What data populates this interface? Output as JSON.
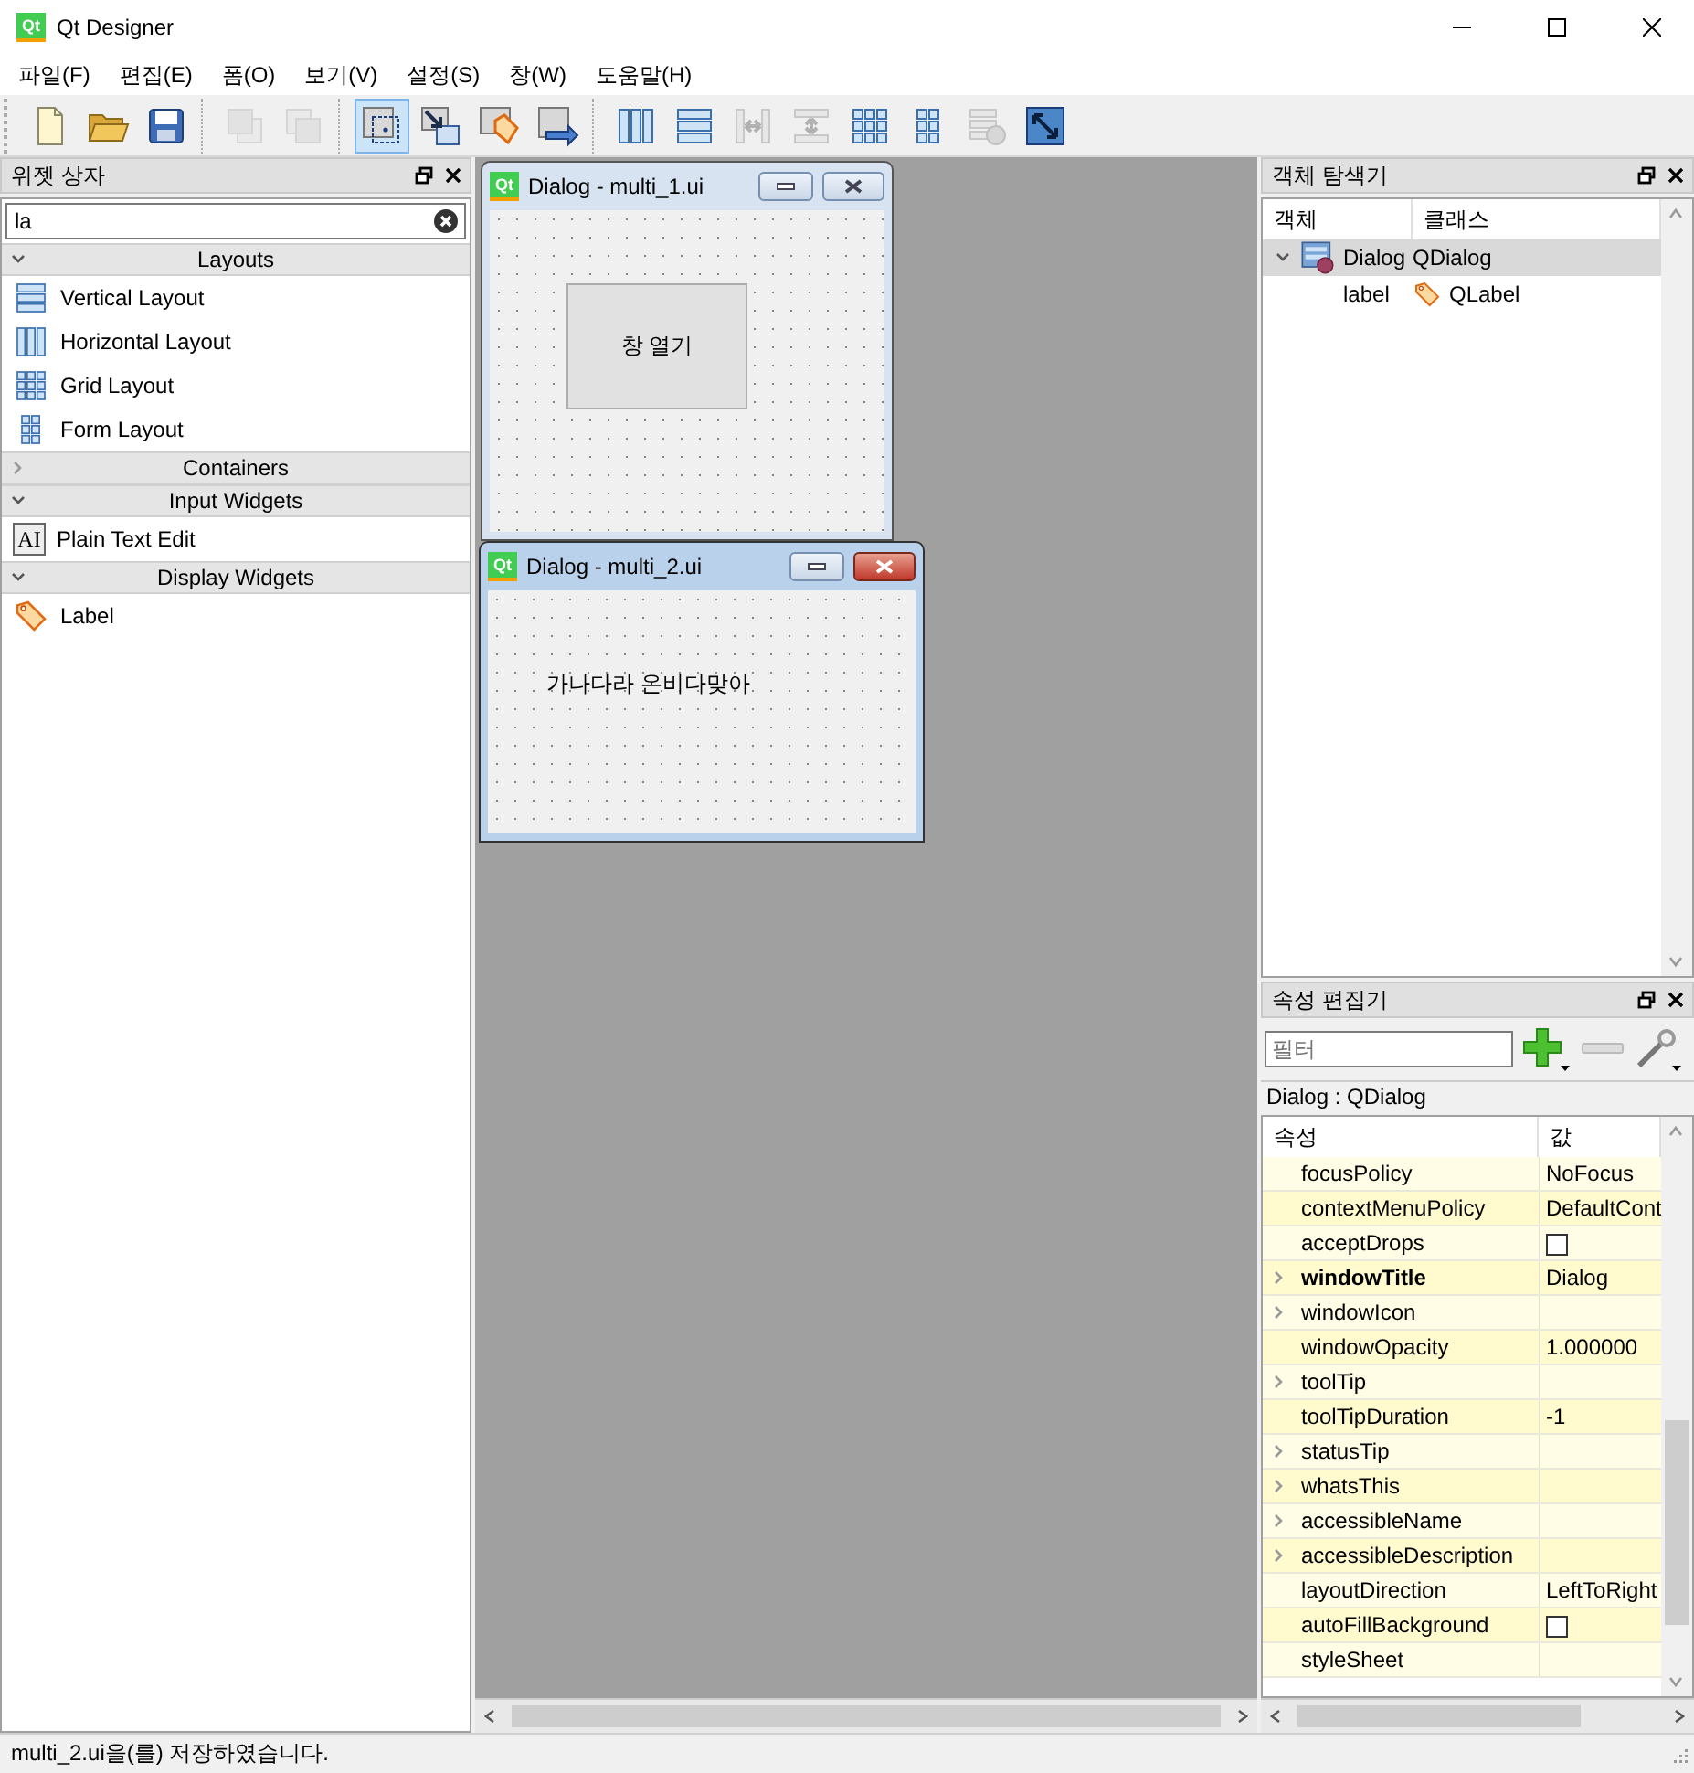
{
  "window": {
    "title": "Qt Designer",
    "logo": "Qt"
  },
  "menu": [
    "파일(F)",
    "편집(E)",
    "폼(O)",
    "보기(V)",
    "설정(S)",
    "창(W)",
    "도움말(H)"
  ],
  "toolbar": [
    [
      {
        "kind": "new",
        "selected": false,
        "disabled": false
      },
      {
        "kind": "open",
        "selected": false,
        "disabled": false
      },
      {
        "kind": "save",
        "selected": false,
        "disabled": false
      }
    ],
    [
      {
        "kind": "back",
        "selected": false,
        "disabled": true
      },
      {
        "kind": "front",
        "selected": false,
        "disabled": true
      }
    ],
    [
      {
        "kind": "widgets",
        "selected": true,
        "disabled": false
      },
      {
        "kind": "signals",
        "selected": false,
        "disabled": false
      },
      {
        "kind": "buddies",
        "selected": false,
        "disabled": false
      },
      {
        "kind": "taborder",
        "selected": false,
        "disabled": false
      }
    ],
    [
      {
        "kind": "hbox",
        "selected": false,
        "disabled": false
      },
      {
        "kind": "vbox",
        "selected": false,
        "disabled": false
      },
      {
        "kind": "hsplit",
        "selected": false,
        "disabled": true
      },
      {
        "kind": "vsplit",
        "selected": false,
        "disabled": true
      },
      {
        "kind": "grid",
        "selected": false,
        "disabled": false
      },
      {
        "kind": "form",
        "selected": false,
        "disabled": false
      },
      {
        "kind": "break",
        "selected": false,
        "disabled": true
      },
      {
        "kind": "adjust",
        "selected": false,
        "disabled": false
      }
    ]
  ],
  "widget_box": {
    "title": "위젯 상자",
    "search": {
      "value": "la"
    },
    "categories": [
      {
        "title": "Layouts",
        "expanded": true,
        "items": [
          {
            "label": "Vertical Layout",
            "kind": "vbox"
          },
          {
            "label": "Horizontal Layout",
            "kind": "hbox"
          },
          {
            "label": "Grid Layout",
            "kind": "grid"
          },
          {
            "label": "Form Layout",
            "kind": "form"
          }
        ]
      },
      {
        "title": "Containers",
        "expanded": false
      },
      {
        "title": "Input Widgets",
        "expanded": true,
        "items": [
          {
            "label": "Plain Text Edit",
            "kind": "textedit",
            "icon_text": "AI"
          }
        ]
      },
      {
        "title": "Display Widgets",
        "expanded": true,
        "items": [
          {
            "label": "Label",
            "kind": "label"
          }
        ]
      }
    ]
  },
  "mdi": {
    "windows": [
      {
        "title": "Dialog - multi_1.ui",
        "logo": "Qt",
        "active": false,
        "widget": {
          "kind": "button",
          "text": "창 열기"
        }
      },
      {
        "title": "Dialog - multi_2.ui",
        "logo": "Qt",
        "active": true,
        "widget": {
          "kind": "label",
          "text": "가나다라 온비다맞아"
        }
      }
    ]
  },
  "object_inspector": {
    "title": "객체 탐색기",
    "columns": [
      "객체",
      "클래스"
    ],
    "tree": [
      {
        "name": "Dialog",
        "class": "QDialog",
        "kind": "dialog",
        "expanded": true,
        "selected": true,
        "children": [
          {
            "name": "label",
            "class": "QLabel",
            "kind": "label",
            "selected": false
          }
        ]
      }
    ]
  },
  "property_editor": {
    "title": "속성 편집기",
    "filter": {
      "placeholder": "필터"
    },
    "object": "Dialog : QDialog",
    "columns": [
      "속성",
      "값"
    ],
    "rows": [
      {
        "name": "focusPolicy",
        "kind": "text",
        "value": "NoFocus",
        "expandable": false,
        "changed": false
      },
      {
        "name": "contextMenuPolicy",
        "kind": "text",
        "value": "DefaultCont",
        "expandable": false,
        "changed": false
      },
      {
        "name": "acceptDrops",
        "kind": "checkbox",
        "checked": false,
        "expandable": false,
        "changed": false
      },
      {
        "name": "windowTitle",
        "kind": "text",
        "value": "Dialog",
        "expandable": true,
        "changed": true
      },
      {
        "name": "windowIcon",
        "kind": "text",
        "expandable": true,
        "changed": false
      },
      {
        "name": "windowOpacity",
        "kind": "text",
        "value": "1.000000",
        "expandable": false,
        "changed": false
      },
      {
        "name": "toolTip",
        "kind": "text",
        "expandable": true,
        "changed": false
      },
      {
        "name": "toolTipDuration",
        "kind": "text",
        "value": "-1",
        "expandable": false,
        "changed": false
      },
      {
        "name": "statusTip",
        "kind": "text",
        "expandable": true,
        "changed": false
      },
      {
        "name": "whatsThis",
        "kind": "text",
        "expandable": true,
        "changed": false
      },
      {
        "name": "accessibleName",
        "kind": "text",
        "expandable": true,
        "changed": false
      },
      {
        "name": "accessibleDescription",
        "kind": "text",
        "expandable": true,
        "changed": false
      },
      {
        "name": "layoutDirection",
        "kind": "text",
        "value": "LeftToRight",
        "expandable": false,
        "changed": false
      },
      {
        "name": "autoFillBackground",
        "kind": "checkbox",
        "checked": false,
        "expandable": false,
        "changed": false
      },
      {
        "name": "styleSheet",
        "kind": "text",
        "expandable": false,
        "changed": false
      }
    ]
  },
  "status_bar": {
    "text": "multi_2.ui을(를) 저장하였습니다."
  }
}
